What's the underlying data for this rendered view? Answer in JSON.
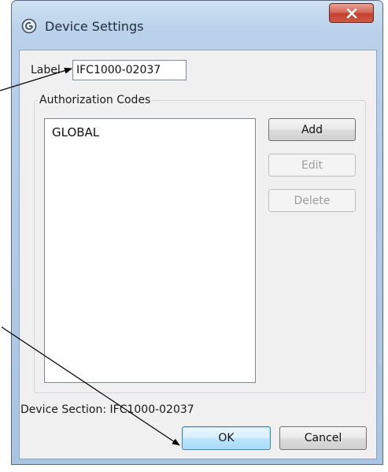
{
  "window": {
    "title": "Device Settings",
    "close_glyph": "×"
  },
  "form": {
    "label_caption": "Label",
    "label_value": "IFC1000-02037"
  },
  "authorization": {
    "group_title": "Authorization Codes",
    "codes": [
      "GLOBAL"
    ]
  },
  "buttons": {
    "add": "Add",
    "edit": "Edit",
    "delete": "Delete",
    "ok": "OK",
    "cancel": "Cancel"
  },
  "status": {
    "device_section": "Device Section: IFC1000-02037"
  },
  "icons": {
    "app": "settings-app-icon",
    "close": "close-icon"
  },
  "colors": {
    "accent_close": "#c2402f",
    "default_button_border": "#3c7fb1"
  }
}
